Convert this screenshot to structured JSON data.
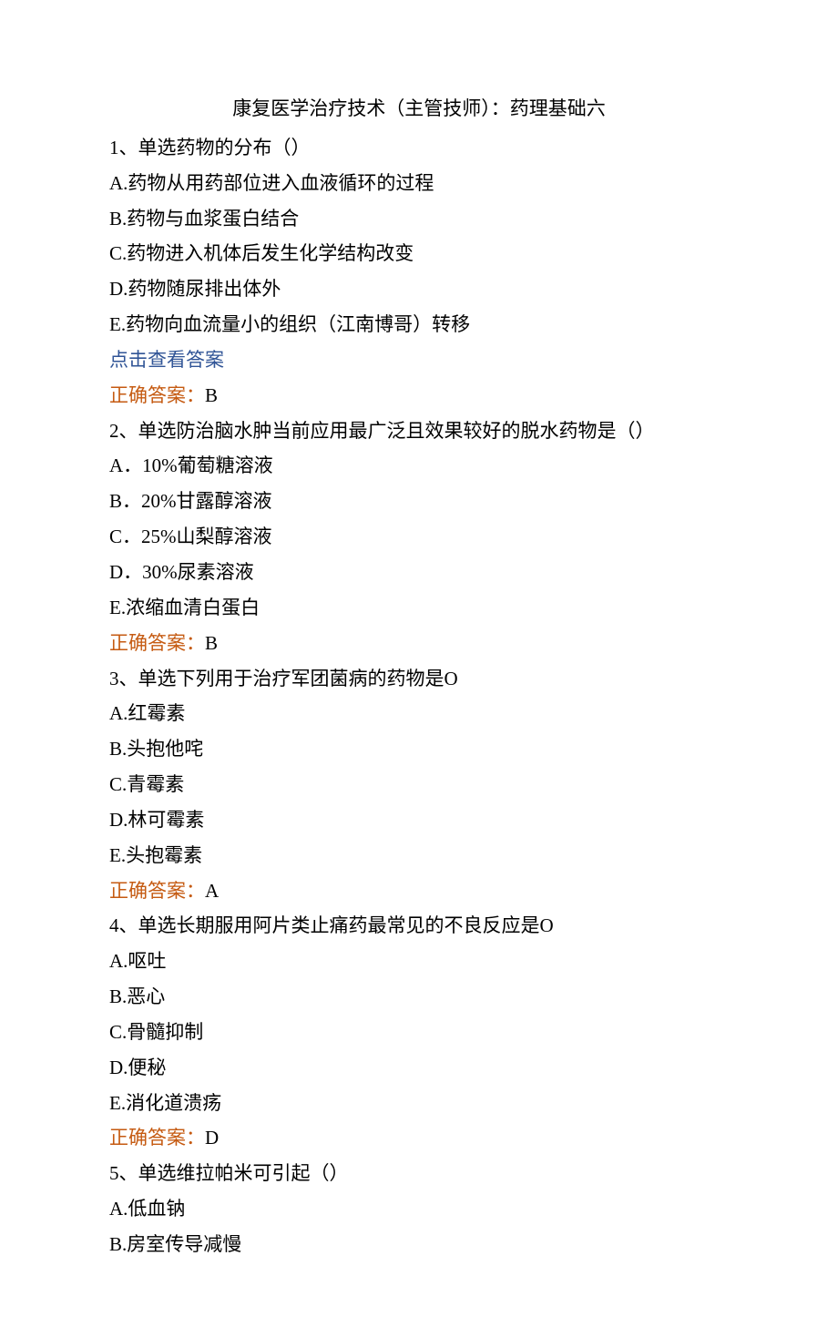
{
  "title": "康复医学治疗技术（主管技师）：药理基础六",
  "q1": {
    "stem": "1、单选药物的分布（）",
    "a": "A.药物从用药部位进入血液循环的过程",
    "b": "B.药物与血浆蛋白结合",
    "c": "C.药物进入机体后发生化学结构改变",
    "d": "D.药物随尿排出体外",
    "e": "E.药物向血流量小的组织（江南博哥）转移",
    "link": "点击查看答案",
    "ans_label": "正确答案：",
    "ans_value": "B"
  },
  "q2": {
    "stem": "2、单选防治脑水肿当前应用最广泛且效果较好的脱水药物是（）",
    "a": "A．10%葡萄糖溶液",
    "b": "B．20%甘露醇溶液",
    "c": "C．25%山梨醇溶液",
    "d": "D．30%尿素溶液",
    "e": "E.浓缩血清白蛋白",
    "ans_label": "正确答案：",
    "ans_value": "B"
  },
  "q3": {
    "stem": "3、单选下列用于治疗军团菌病的药物是O",
    "a": "A.红霉素",
    "b": "B.头抱他咤",
    "c": "C.青霉素",
    "d": "D.林可霉素",
    "e": "E.头抱霉素",
    "ans_label": "正确答案：",
    "ans_value": "A"
  },
  "q4": {
    "stem": "4、单选长期服用阿片类止痛药最常见的不良反应是O",
    "a": "A.呕吐",
    "b": "B.恶心",
    "c": "C.骨髓抑制",
    "d": "D.便秘",
    "e": "E.消化道溃疡",
    "ans_label": "正确答案：",
    "ans_value": "D"
  },
  "q5": {
    "stem": "5、单选维拉帕米可引起（）",
    "a": "A.低血钠",
    "b": "B.房室传导减慢"
  }
}
